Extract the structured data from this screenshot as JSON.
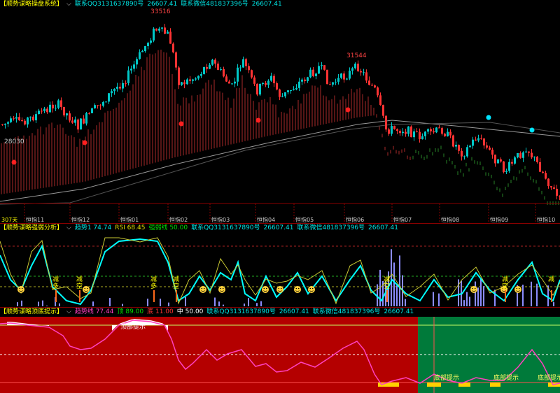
{
  "colors": {
    "up": "#00c8c8",
    "down": "#ff3333",
    "volume_red": "#c83232",
    "volume_green": "#2f9a2f",
    "ma": "#ffffff",
    "signal_dot_red": "#ff2020",
    "signal_dot_cyan": "#00e5ff",
    "osc_main": "#00ffff",
    "osc_rsi": "#c8c832",
    "osc_bars": "#8c8cff",
    "bottom_red_zone": "#b40000",
    "bottom_green_zone": "#007a3a",
    "bottom_line": "#ff40c0",
    "bottom_fill_top": "#ffffff",
    "bottom_fill_low": "#ffd000",
    "marker_bull": "#ffd23c"
  },
  "panel1": {
    "title": "【顺势谋略操盘系统】",
    "contact_qq": "联系QQ3131637890号",
    "value_1": "26607.41",
    "contact_wx": "联系微信481837396号",
    "value_2": "26607.41",
    "peak_label": "33516",
    "peak2_label": "31544",
    "low_label": "28030",
    "days_label": "307天",
    "x_ticks": [
      "恒指11",
      "恒指12",
      "恒指01",
      "恒指02",
      "恒指03",
      "恒指04",
      "恒指05",
      "恒指06",
      "恒指07",
      "恒指08",
      "恒指09",
      "恒指10"
    ]
  },
  "panel2": {
    "title": "【顺势谋略强弱分析】",
    "trend_label": "趋势1 74.74",
    "rsi_label": "RSI 68.45",
    "strongweak_label": "强弱线 50.00",
    "contact_qq": "联系QQ3131637890号",
    "value_1": "26607.41",
    "contact_wx": "联系微信481837396号",
    "value_2": "26607.41",
    "mark_reduce_long": "减多",
    "mark_reduce_short": "减空",
    "mark_reduce": "减"
  },
  "panel3": {
    "title": "【顺势谋略顶底提示】",
    "trend_label": "趋势线 77.44",
    "top_label": "顶 89.00",
    "bottom_label": "底 11.00",
    "mid_label": "中 50.00",
    "contact_qq": "联系QQ3131637890号",
    "value_1": "26607.41",
    "contact_wx": "联系微信481837396号",
    "value_2": "26607.41",
    "top_hint": "顶部提示",
    "bottom_hint": "底部提示"
  }
}
